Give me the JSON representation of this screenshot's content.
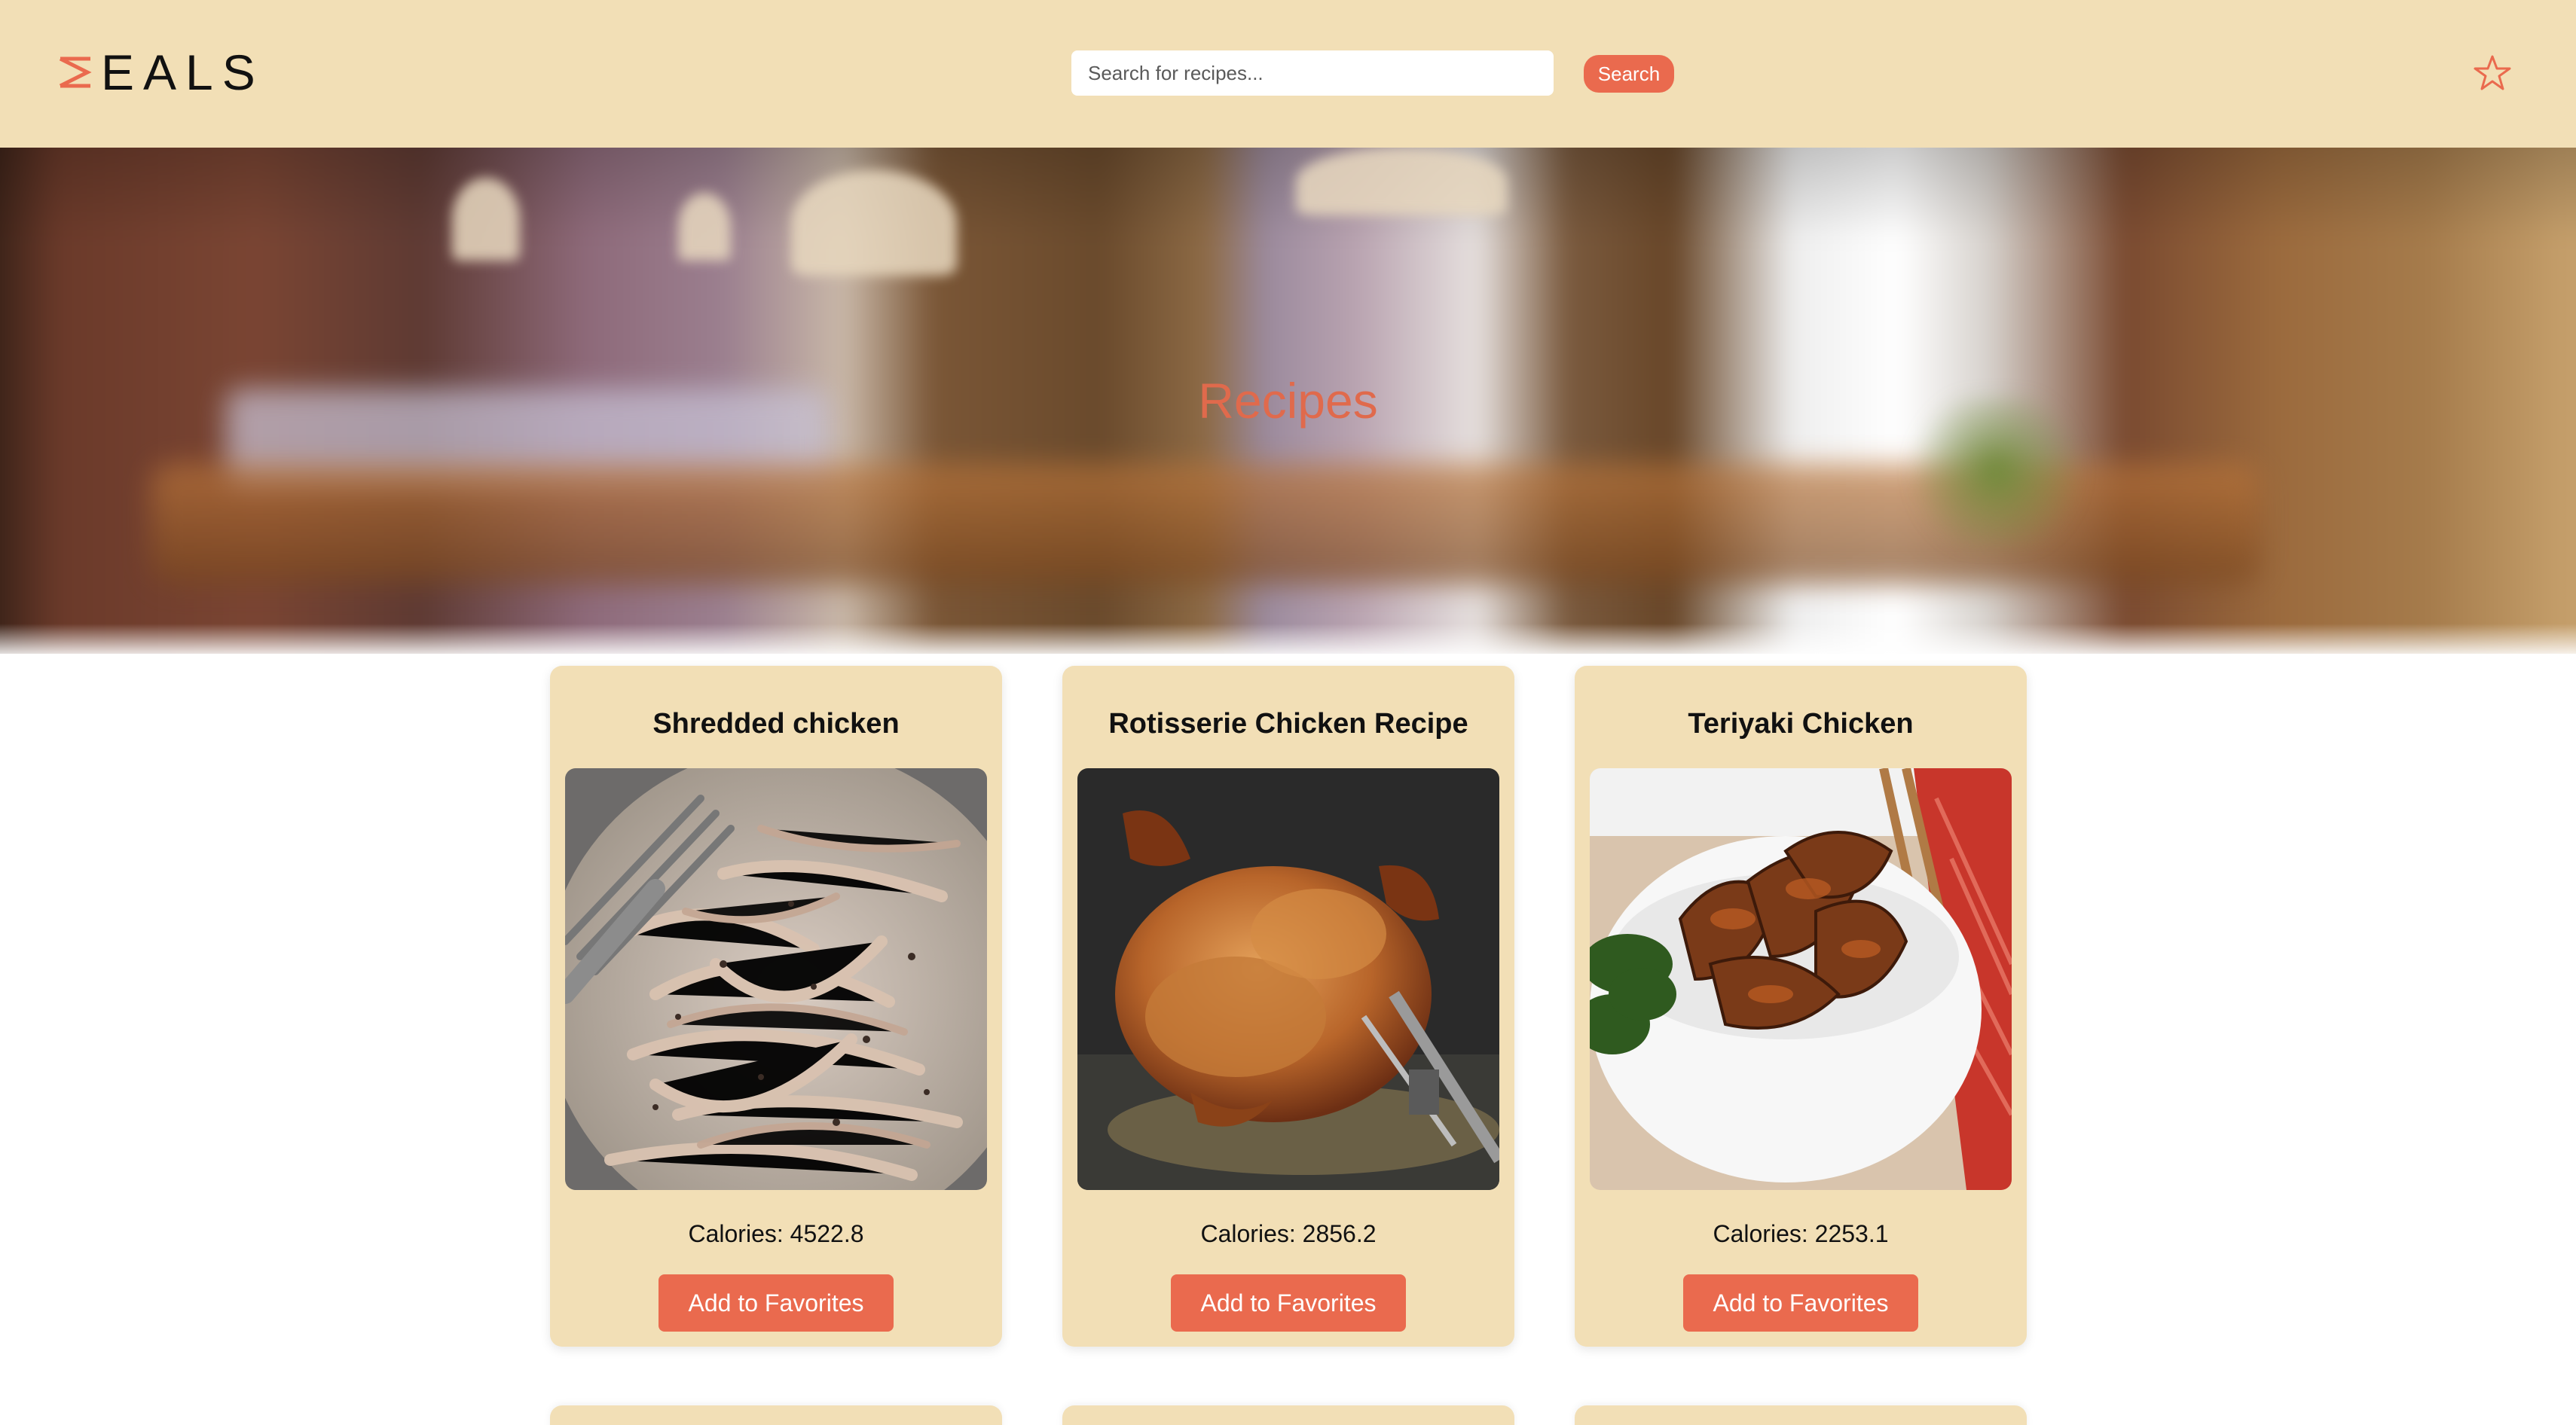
{
  "header": {
    "logo_text": "EALS",
    "search": {
      "placeholder": "Search for recipes...",
      "value": ""
    },
    "search_button_label": "Search",
    "favorites_icon": "star-outline-icon"
  },
  "hero": {
    "title": "Recipes"
  },
  "recipes": [
    {
      "title": "Shredded chicken",
      "calories_text": "Calories: 4522.8",
      "button_label": "Add to Favorites",
      "image": "shredded-chicken-photo"
    },
    {
      "title": "Rotisserie Chicken Recipe",
      "calories_text": "Calories: 2856.2",
      "button_label": "Add to Favorites",
      "image": "rotisserie-chicken-photo"
    },
    {
      "title": "Teriyaki Chicken",
      "calories_text": "Calories: 2253.1",
      "button_label": "Add to Favorites",
      "image": "teriyaki-chicken-photo"
    }
  ],
  "colors": {
    "header_bg": "#f2dfb6",
    "accent": "#ea6a4e",
    "hero_title": "#e06a4c",
    "card_bg": "#f2dfb6"
  }
}
